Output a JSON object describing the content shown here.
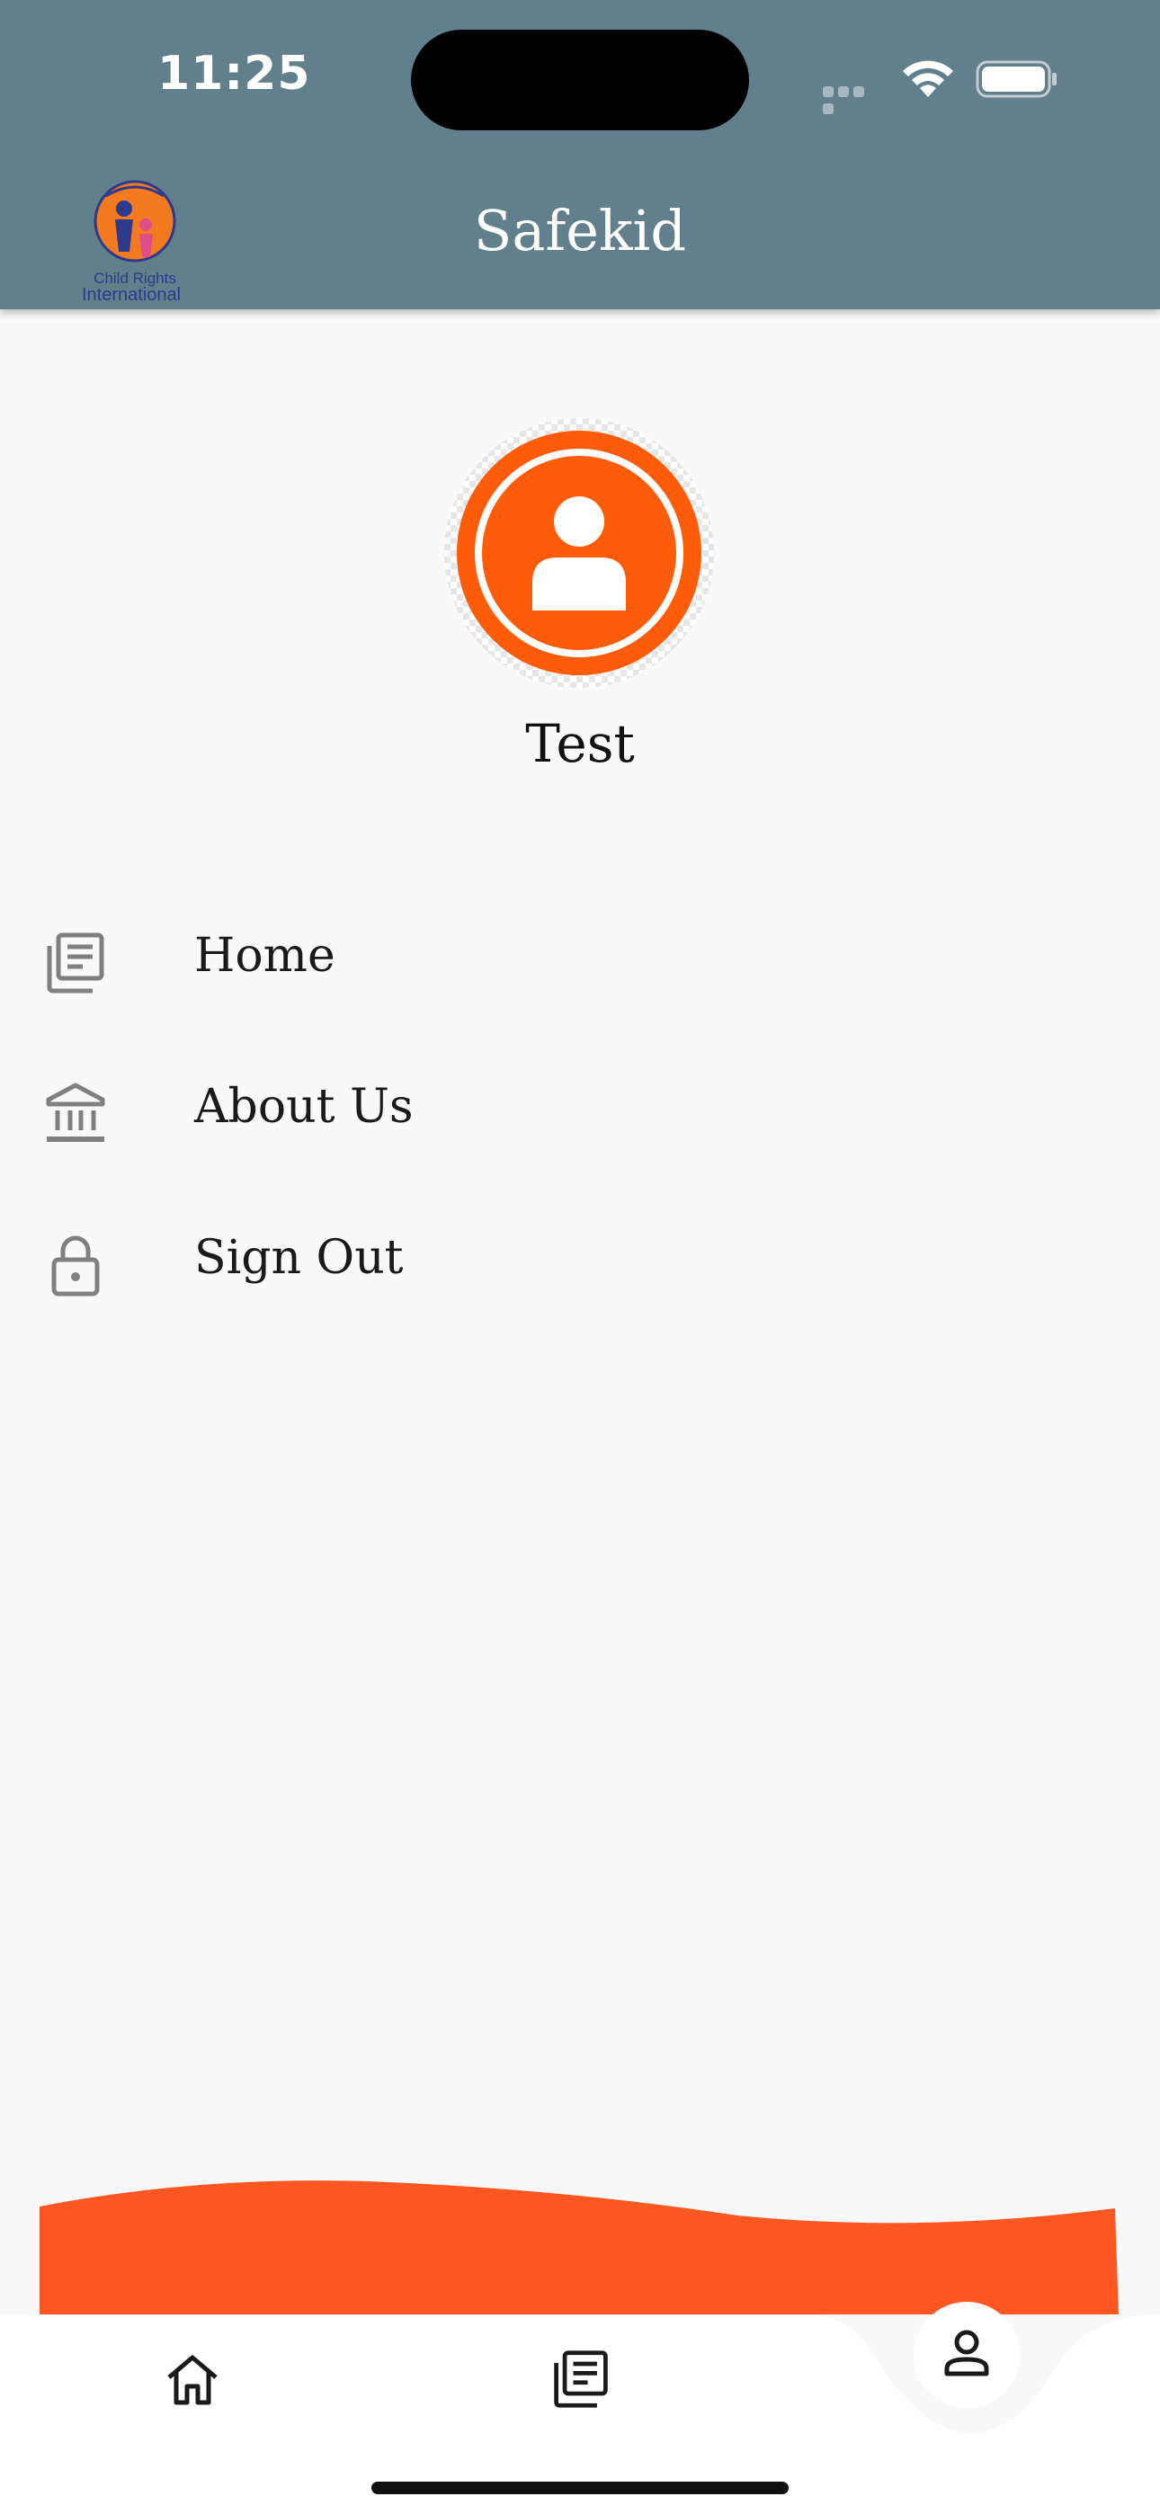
{
  "status_bar": {
    "time": "11:25"
  },
  "header": {
    "title": "Safekid",
    "logo_text_line1": "Child Rights",
    "logo_text_line2": "International"
  },
  "profile": {
    "name": "Test"
  },
  "menu": [
    {
      "label": "Home",
      "icon": "newspaper-icon"
    },
    {
      "label": "About Us",
      "icon": "bank-icon"
    },
    {
      "label": "Sign Out",
      "icon": "lock-icon"
    }
  ],
  "bottom_nav": {
    "items": [
      {
        "icon": "home-icon"
      },
      {
        "icon": "newspaper-icon"
      },
      {
        "icon": "person-icon",
        "active": true
      }
    ]
  },
  "colors": {
    "header": "#627f8c",
    "accent": "#ff5722",
    "background": "#f9f9f9"
  }
}
